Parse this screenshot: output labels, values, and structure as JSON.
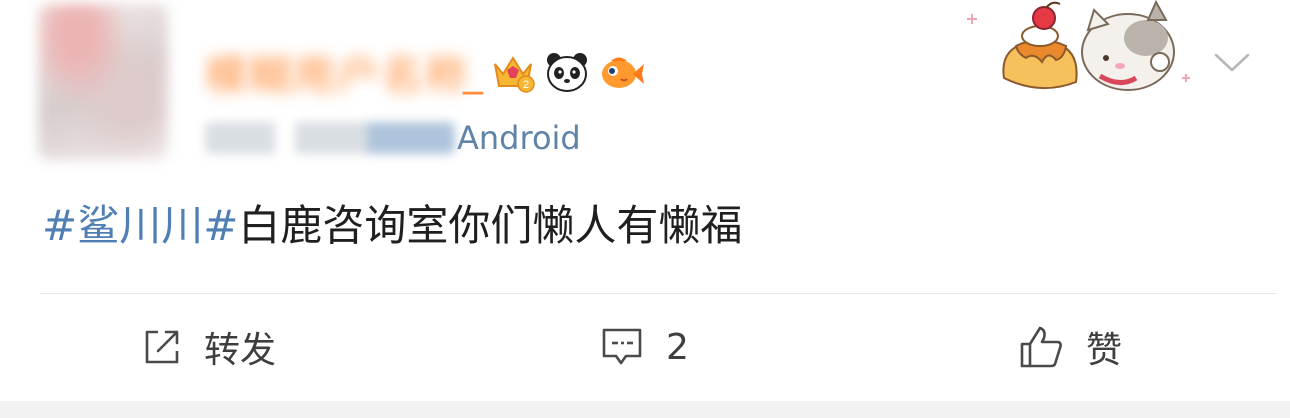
{
  "user": {
    "name_visible": "_",
    "badges": [
      "crown-badge-icon",
      "panda-icon",
      "goldfish-icon"
    ]
  },
  "meta": {
    "source_suffix": "Android"
  },
  "post": {
    "topic": "#鲨川川#",
    "text": "白鹿咨询室你们懒人有懒福"
  },
  "actions": {
    "repost_label": "转发",
    "comment_count": "2",
    "like_label": "赞"
  },
  "colors": {
    "username": "#ff8d3a",
    "topic_link": "#4f7fb4",
    "meta_link": "#5f84a8",
    "text": "#1f1f1f"
  }
}
